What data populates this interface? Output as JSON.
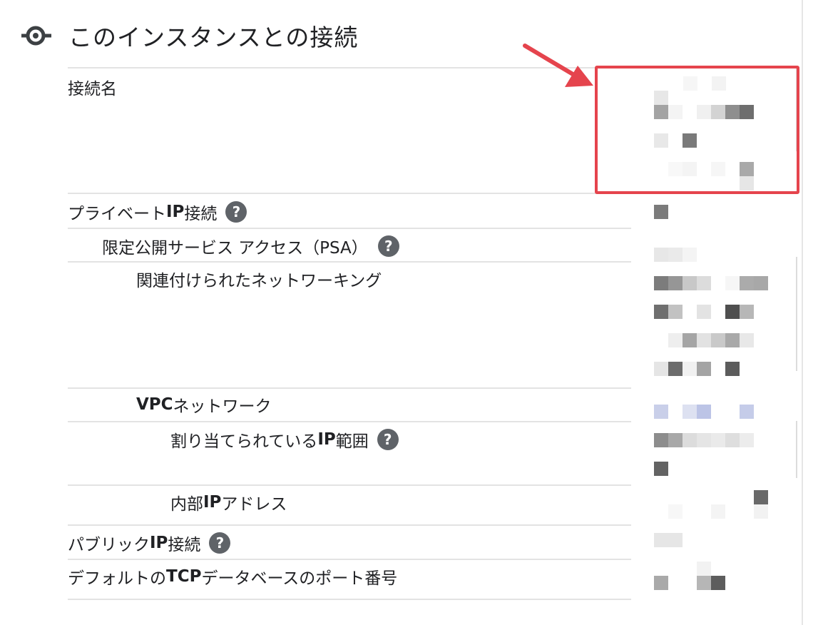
{
  "section": {
    "title": "このインスタンスとの接続",
    "icon": "connection-icon"
  },
  "rows": {
    "connection_name": "接続名",
    "private_ip": {
      "prefix": "プライベート ",
      "bold": "IP",
      "suffix": " 接続"
    },
    "psa": "限定公開サービス アクセス（PSA）",
    "associated_networking": "関連付けられたネットワーキング",
    "vpc_network": {
      "bold": "VPC",
      "suffix": " ネットワーク"
    },
    "allocated_ip_range": {
      "prefix": "割り当てられている ",
      "bold": "IP",
      "suffix": " 範囲"
    },
    "internal_ip": {
      "prefix": "内部 ",
      "bold": "IP",
      "suffix": " アドレス"
    },
    "public_ip": {
      "prefix": "パブリック ",
      "bold": "IP",
      "suffix": " 接続"
    },
    "default_tcp_port": {
      "prefix": "デフォルトの ",
      "bold": "TCP",
      "suffix": " データベースのポート番号"
    }
  },
  "help_glyph": "?",
  "colors": {
    "highlight_red": "#e5444d",
    "help_icon_bg": "#5f6368",
    "divider": "#e3e3e3"
  }
}
